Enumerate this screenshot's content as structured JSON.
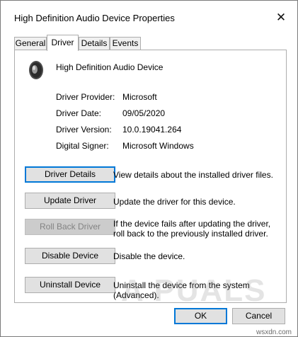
{
  "window": {
    "title": "High Definition Audio Device Properties",
    "close_glyph": "✕"
  },
  "tabs": [
    {
      "label": "General",
      "active": false
    },
    {
      "label": "Driver",
      "active": true
    },
    {
      "label": "Details",
      "active": false
    },
    {
      "label": "Events",
      "active": false
    }
  ],
  "device": {
    "name": "High Definition Audio Device",
    "icon": "speaker-icon"
  },
  "info": [
    {
      "label": "Driver Provider:",
      "value": "Microsoft"
    },
    {
      "label": "Driver Date:",
      "value": "09/05/2020"
    },
    {
      "label": "Driver Version:",
      "value": "10.0.19041.264"
    },
    {
      "label": "Digital Signer:",
      "value": "Microsoft Windows"
    }
  ],
  "actions": [
    {
      "label": "Driver Details",
      "description": "View details about the installed driver files.",
      "enabled": true,
      "focused": true
    },
    {
      "label": "Update Driver",
      "description": "Update the driver for this device.",
      "enabled": true,
      "focused": false
    },
    {
      "label": "Roll Back Driver",
      "description": "If the device fails after updating the driver, roll back to the previously installed driver.",
      "enabled": false,
      "focused": false
    },
    {
      "label": "Disable Device",
      "description": "Disable the device.",
      "enabled": true,
      "focused": false
    },
    {
      "label": "Uninstall Device",
      "description": "Uninstall the device from the system (Advanced).",
      "enabled": true,
      "focused": false
    }
  ],
  "footer": {
    "ok_label": "OK",
    "cancel_label": "Cancel"
  },
  "watermark": {
    "text": "A PUALS",
    "site": "wsxdn.com"
  },
  "colors": {
    "accent": "#0078d7",
    "button_bg": "#e1e1e1",
    "disabled_text": "#838383"
  }
}
